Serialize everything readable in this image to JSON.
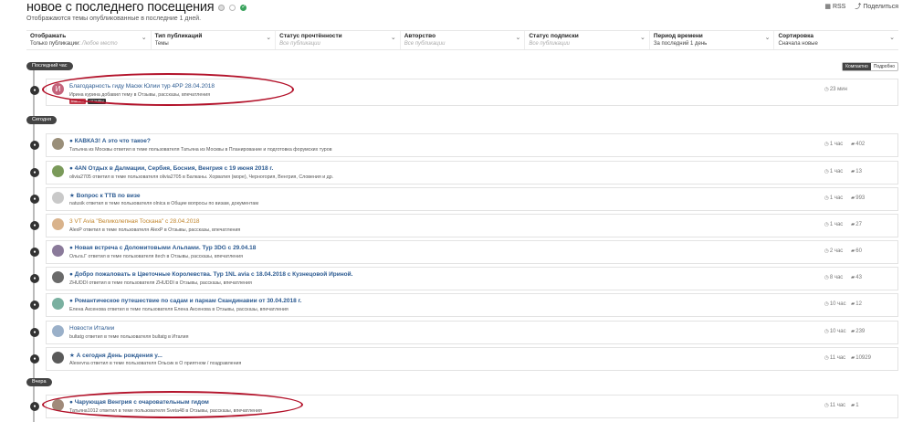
{
  "header": {
    "title": "новое с последнего посещения",
    "subtitle": "Отображаются темы опубликованные в последние 1 дней.",
    "rss": "RSS",
    "share": "Поделиться"
  },
  "filters": [
    {
      "label": "Отображать",
      "value": "Только публикации",
      "placeholder": "Любое место"
    },
    {
      "label": "Тип публикаций",
      "value": "Темы",
      "placeholder": ""
    },
    {
      "label": "Статус прочтённости",
      "value": "",
      "placeholder": "Все публикации"
    },
    {
      "label": "Авторство",
      "value": "",
      "placeholder": "Все публикации"
    },
    {
      "label": "Статус подписки",
      "value": "",
      "placeholder": "Все публикации"
    },
    {
      "label": "Период времени",
      "value": "За последний 1 день",
      "placeholder": ""
    },
    {
      "label": "Сортировка",
      "value": "Сначала новые",
      "placeholder": ""
    }
  ],
  "view": {
    "compact": "Компактно",
    "expanded": "Подробно"
  },
  "sections": {
    "last_hour": "Последний час",
    "today": "Сегодня",
    "yesterday": "Вчера"
  },
  "rows": [
    {
      "title": "Благодарность гиду Маскк Юлии тур 4PP 28.04.2018",
      "meta": "Ирина курина добавил тему в Отзывы, рассказы, впечатления",
      "time": "23 мин",
      "count": "",
      "tags": [
        "Маск...",
        "отзывы"
      ]
    },
    {
      "title": "● КАВКАЗ! А это что такое?",
      "meta": "Татьяна из Москвы ответил в теме пользователя Татьяна из Москвы в Планирование и подготовка форумских туров",
      "time": "1 час",
      "count": "402"
    },
    {
      "title": "● 4AN Отдых в Далмации, Сербия, Босния, Венгрия с 19 июня 2018 г.",
      "meta": "olivia2705 ответил в теме пользователя olivia2705 в Балканы. Хорватия (море), Черногория, Венгрия, Словения и др.",
      "time": "1 час",
      "count": "13"
    },
    {
      "title": "★ Вопрос к ТТВ по визе",
      "meta": "natusik ответил в теме пользователя olnica в Общие вопросы по визам, документам",
      "time": "1 час",
      "count": "993"
    },
    {
      "title": "3 VT Avia \"Великолепная Тоскана\" с 28.04.2018",
      "meta": "AlexP ответил в теме пользователя AlexP в Отзывы, рассказы, впечатления",
      "time": "1 час",
      "count": "27"
    },
    {
      "title": "● Новая встреча с Доломитовыми Альпами. Тур 3DG с 29.04.18",
      "meta": "Ольга.Г ответил в теме пользователя itech в Отзывы, рассказы, впечатления",
      "time": "2 час",
      "count": "60"
    },
    {
      "title": "● Добро пожаловать в Цветочные Королевства. Тур 1NL avia с 18.04.2018 с Кузнецовой Ириной.",
      "meta": "ZHUDDI ответил в теме пользователя ZHUDDI в Отзывы, рассказы, впечатления",
      "time": "8 час",
      "count": "43"
    },
    {
      "title": "● Романтическое путешествие по садам и паркам Скандинавии от 30.04.2018 г.",
      "meta": "Елена Аксенова ответил в теме пользователя Елена Аксенова в Отзывы, рассказы, впечатления",
      "time": "10 час",
      "count": "12"
    },
    {
      "title": "Новости Италии",
      "meta": "bultatg ответил в теме пользователя bultatg в Италия",
      "time": "10 час",
      "count": "239"
    },
    {
      "title": "★ А сегодня День рождения у...",
      "meta": "Alexevna ответил в теме пользователя Ольсик в О приятном / поздравления",
      "time": "11 час",
      "count": "10929"
    },
    {
      "title": "● Чарующая Венгрия с очаровательным гидом",
      "meta": "Татьяна1012 ответил в теме пользователя Sveta48 в Отзывы, рассказы, впечатления",
      "time": "11 час",
      "count": "1"
    }
  ]
}
